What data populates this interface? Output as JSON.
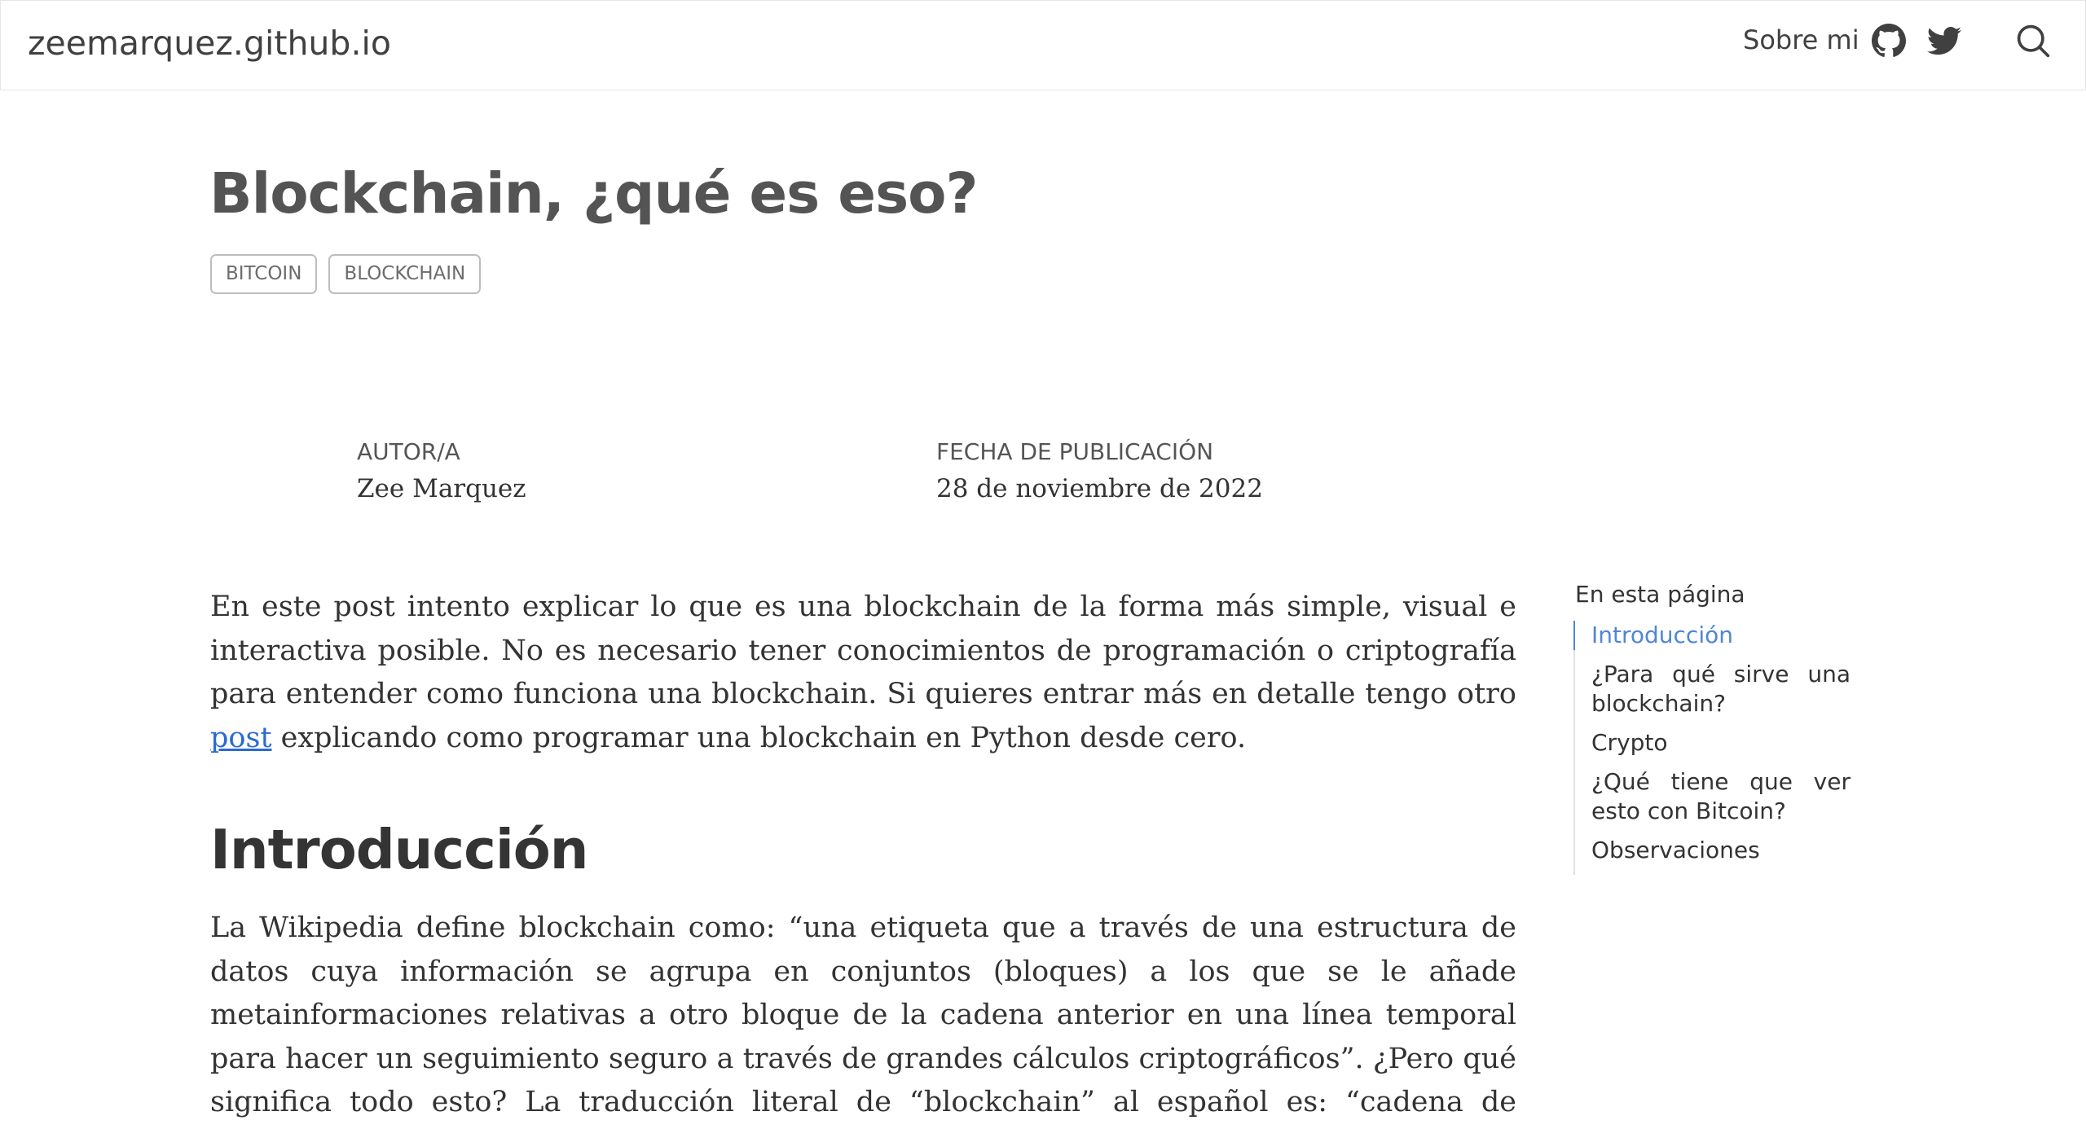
{
  "header": {
    "brand": "zeemarquez.github.io",
    "about_label": "Sobre mi",
    "icons": [
      "github-icon",
      "twitter-icon",
      "search-icon"
    ]
  },
  "post": {
    "title": "Blockchain, ¿qué es eso?",
    "tags": [
      "BITCOIN",
      "BLOCKCHAIN"
    ],
    "author_label": "AUTOR/A",
    "author": "Zee Marquez",
    "date_label": "FECHA DE PUBLICACIÓN",
    "date": "28 de noviembre de 2022"
  },
  "article": {
    "intro_part1": "En este post intento explicar lo que es una blockchain de la forma más simple, visual e interactiva posible. No es necesario tener conocimientos de programación o criptografía para entender como funciona una blockchain. Si quieres entrar más en detalle tengo otro ",
    "intro_link": "post",
    "intro_part2": " explicando como programar una blockchain en Python desde cero.",
    "section_heading": "Introducción",
    "section_paragraph": "La Wikipedia define blockchain como: “una etiqueta que a través de una estructura de datos cuya información se agrupa en conjuntos (bloques) a los que se le añade metainformaciones relativas a otro bloque de la cadena anterior en una línea temporal para hacer un seguimiento seguro a través de grandes cálculos criptográficos”. ¿Pero qué significa todo esto? La traducción literal de “blockchain” al español es: “cadena de bloques”. Pero ¿qué son estos “bloques”?, ¿y por qué están “encadenados”?"
  },
  "toc": {
    "title": "En esta página",
    "items": [
      {
        "label": "Introducción",
        "active": true
      },
      {
        "label": "¿Para qué sirve una blockchain?",
        "active": false
      },
      {
        "label": "Crypto",
        "active": false
      },
      {
        "label": "¿Qué tiene que ver esto con Bitcoin?",
        "active": false
      },
      {
        "label": "Observaciones",
        "active": false
      }
    ]
  },
  "colors": {
    "link": "#2a6bd1",
    "toc_active": "#4f86d6",
    "heading": "#545454"
  }
}
